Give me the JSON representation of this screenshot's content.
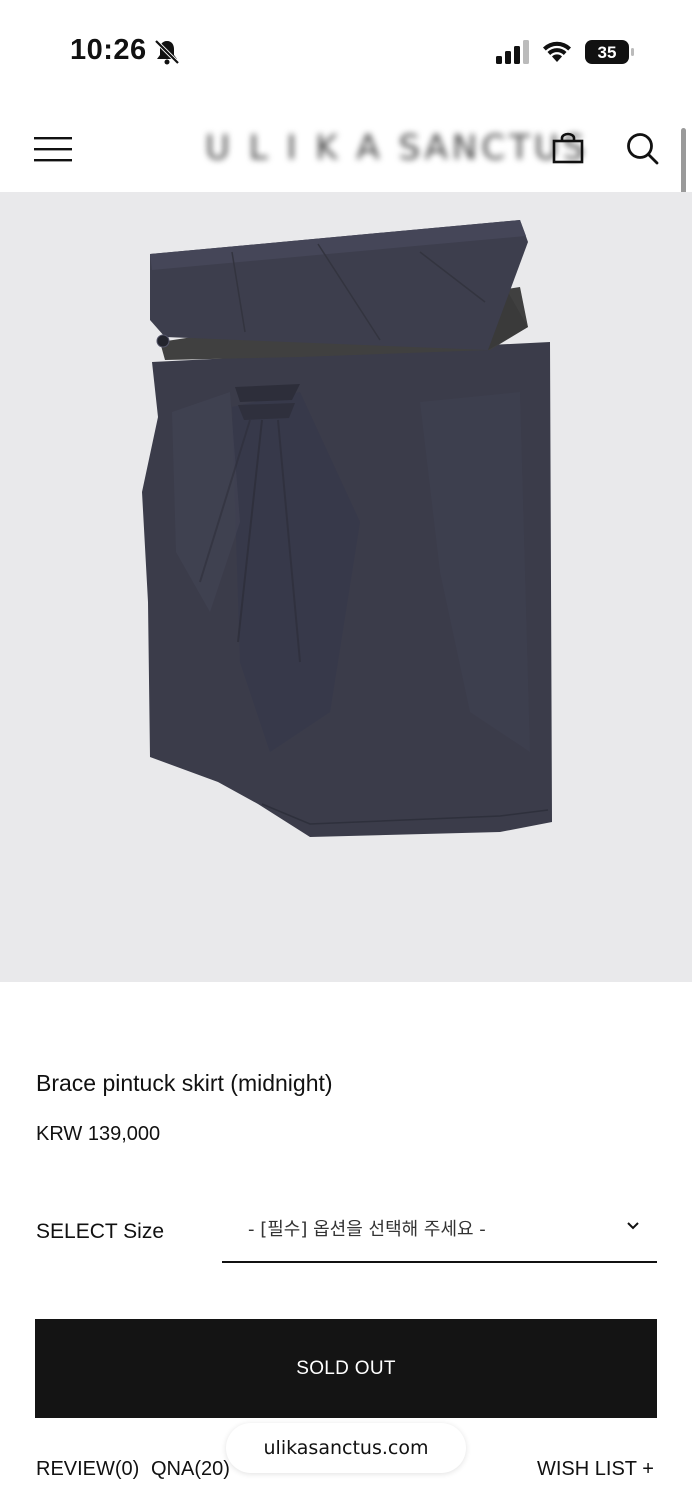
{
  "status_bar": {
    "time": "10:26",
    "battery_level": "35",
    "icons": [
      "bell-slash-icon",
      "cellular-signal-icon",
      "wifi-icon",
      "battery-icon"
    ]
  },
  "header": {
    "logo_text": "U L I K A SANCTUS",
    "icons": [
      "hamburger-menu-icon",
      "shopping-bag-icon",
      "search-icon"
    ]
  },
  "product": {
    "name": "Brace pintuck skirt (midnight)",
    "price": "KRW 139,000",
    "image_colors": {
      "background": "#e9e9eb",
      "fabric": "#3b3c4a",
      "waistband": "#3f3f3f"
    }
  },
  "options": {
    "label": "SELECT Size",
    "selected": "- [필수] 옵션을 선택해 주세요 -"
  },
  "actions": {
    "sold_out_label": "SOLD OUT"
  },
  "tabs": {
    "review": "REVIEW(0)",
    "qna": "QNA(20)",
    "wishlist": "WISH LIST +"
  },
  "browser": {
    "url": "ulikasanctus.com"
  }
}
